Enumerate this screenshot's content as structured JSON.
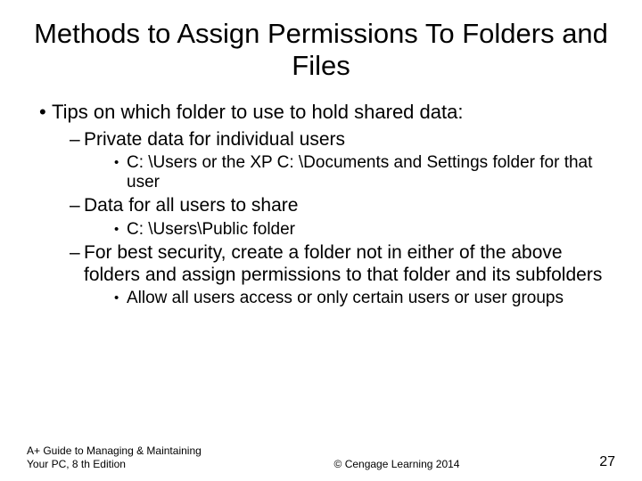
{
  "title": "Methods to Assign Permissions To Folders and Files",
  "bullets": {
    "b1": "Tips on which folder to use to hold shared data:",
    "b1_1": "Private data for individual users",
    "b1_1_1": "C: \\Users or the XP C: \\Documents and Settings folder for that user",
    "b1_2": "Data for all users to share",
    "b1_2_1": "C: \\Users\\Public folder",
    "b1_3": "For best security, create a folder not in either of the above folders and assign permissions to that folder and its subfolders",
    "b1_3_1": "Allow all users access or only certain users or user groups"
  },
  "footer": {
    "left": "A+ Guide to Managing & Maintaining Your PC, 8 th Edition",
    "center": "©  Cengage Learning 2014",
    "page": "27"
  }
}
